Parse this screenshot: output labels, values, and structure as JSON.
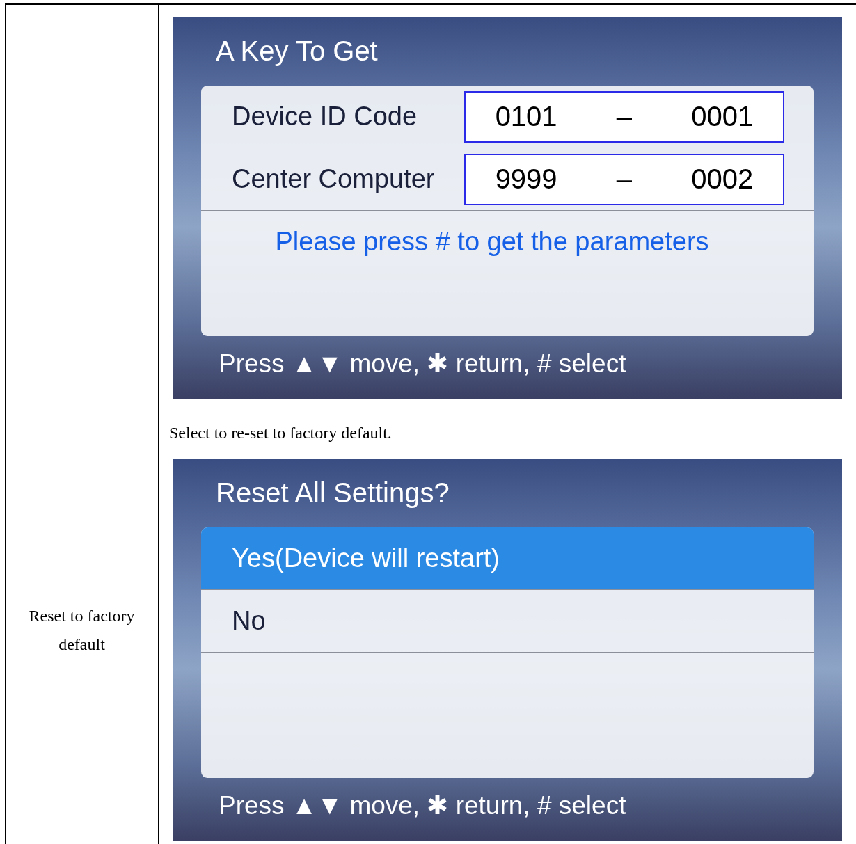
{
  "table": {
    "rows": [
      {
        "description": null,
        "screen": {
          "title": "A Key To Get",
          "items": [
            {
              "kind": "field",
              "label": "Device ID Code",
              "value_1": "0101",
              "separator": "–",
              "value_2": "0001"
            },
            {
              "kind": "field",
              "label": "Center Computer",
              "value_1": "9999",
              "separator": "–",
              "value_2": "0002"
            },
            {
              "kind": "message",
              "text": "Please press # to get the parameters"
            },
            {
              "kind": "empty"
            }
          ],
          "footer": "Press ▲▼ move, ✱ return, # select"
        }
      },
      {
        "label": "Reset to factory default",
        "description": "Select to re-set to factory default.",
        "screen": {
          "title": "Reset All Settings?",
          "items": [
            {
              "kind": "option",
              "label": "Yes(Device will restart)",
              "selected": true
            },
            {
              "kind": "option",
              "label": "No",
              "selected": false
            },
            {
              "kind": "empty"
            },
            {
              "kind": "empty"
            }
          ],
          "footer": "Press ▲▼ move, ✱ return, # select"
        }
      }
    ]
  }
}
